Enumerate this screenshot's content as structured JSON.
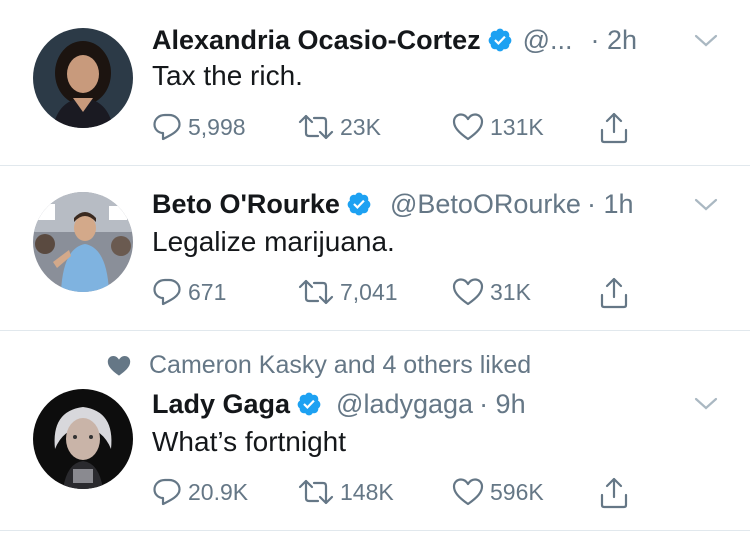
{
  "tweets": [
    {
      "name": "Alexandria Ocasio-Cortez",
      "handle": "@...",
      "time": "· 2h",
      "text": "Tax the rich.",
      "replies": "5,998",
      "retweets": "23K",
      "likes": "131K"
    },
    {
      "name": "Beto O'Rourke",
      "handle": "@BetoORourke",
      "time": "· 1h",
      "text": "Legalize marijuana.",
      "replies": "671",
      "retweets": "7,041",
      "likes": "31K"
    },
    {
      "social_context": "Cameron Kasky and 4 others liked",
      "name": "Lady Gaga",
      "handle": "@ladygaga",
      "time": "· 9h",
      "text": "What’s fortnight",
      "replies": "20.9K",
      "retweets": "148K",
      "likes": "596K"
    }
  ],
  "colors": {
    "verified": "#1da1f2",
    "secondary_text": "#657786",
    "divider": "#e1e8ed"
  },
  "icons": [
    "verified-badge-icon",
    "chevron-down-icon",
    "reply-icon",
    "retweet-icon",
    "like-icon",
    "share-icon",
    "heart-filled-icon"
  ]
}
